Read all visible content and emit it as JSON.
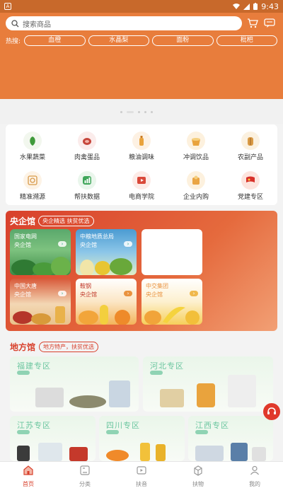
{
  "status_bar": {
    "time": "9:43"
  },
  "search": {
    "placeholder": "搜索商品"
  },
  "hot": {
    "label": "热搜:",
    "tags": [
      "血橙",
      "水晶梨",
      "面粉",
      "枇杷"
    ]
  },
  "categories": [
    {
      "label": "水果蔬菜",
      "icon": "vegetable-icon",
      "color": "#f2f7ee"
    },
    {
      "label": "肉禽蛋品",
      "icon": "meat-icon",
      "color": "#fbeceb"
    },
    {
      "label": "粮油调味",
      "icon": "oil-bottle-icon",
      "color": "#fdf1e3"
    },
    {
      "label": "冲调饮品",
      "icon": "drink-icon",
      "color": "#fdf1de"
    },
    {
      "label": "农副产品",
      "icon": "grain-icon",
      "color": "#fbf1e0"
    },
    {
      "label": "精准溯源",
      "icon": "trace-icon",
      "color": "#fdf3e6"
    },
    {
      "label": "帮扶数据",
      "icon": "data-chart-icon",
      "color": "#eaf6ec"
    },
    {
      "label": "电商学院",
      "icon": "academy-icon",
      "color": "#fdebe7"
    },
    {
      "label": "企业内购",
      "icon": "enterprise-icon",
      "color": "#fdf1de"
    },
    {
      "label": "党建专区",
      "icon": "party-flag-icon",
      "color": "#fde4de"
    }
  ],
  "central": {
    "title": "央企馆",
    "badge": "央企精选 扶贫优选",
    "cards": [
      {
        "name": "国家电网",
        "sub": "央企馆",
        "color": "#5aa86c"
      },
      {
        "name": "中粮地质总局",
        "sub": "央企馆",
        "color": "#4b9bd2"
      },
      {
        "name": "",
        "sub": "",
        "color": "#ffffff"
      },
      {
        "name": "中国大唐",
        "sub": "央企馆",
        "color": "#d85a3a"
      },
      {
        "name": "鞍钢",
        "sub": "央企馆",
        "color": "#e9923f"
      },
      {
        "name": "中交集团",
        "sub": "央企馆",
        "color": "#f0b84b"
      }
    ]
  },
  "local": {
    "title": "地方馆",
    "badge": "地方特产，扶贫优选",
    "zones": [
      "福建专区",
      "河北专区",
      "江苏专区",
      "四川专区",
      "江西专区"
    ]
  },
  "nav": [
    {
      "label": "首页",
      "icon": "home-icon",
      "active": true
    },
    {
      "label": "分类",
      "icon": "category-icon",
      "active": false
    },
    {
      "label": "扶音",
      "icon": "video-icon",
      "active": false
    },
    {
      "label": "扶物",
      "icon": "goods-icon",
      "active": false
    },
    {
      "label": "我的",
      "icon": "user-icon",
      "active": false
    }
  ],
  "colors": {
    "brand": "#e87d3c",
    "accent": "#d8402c"
  }
}
